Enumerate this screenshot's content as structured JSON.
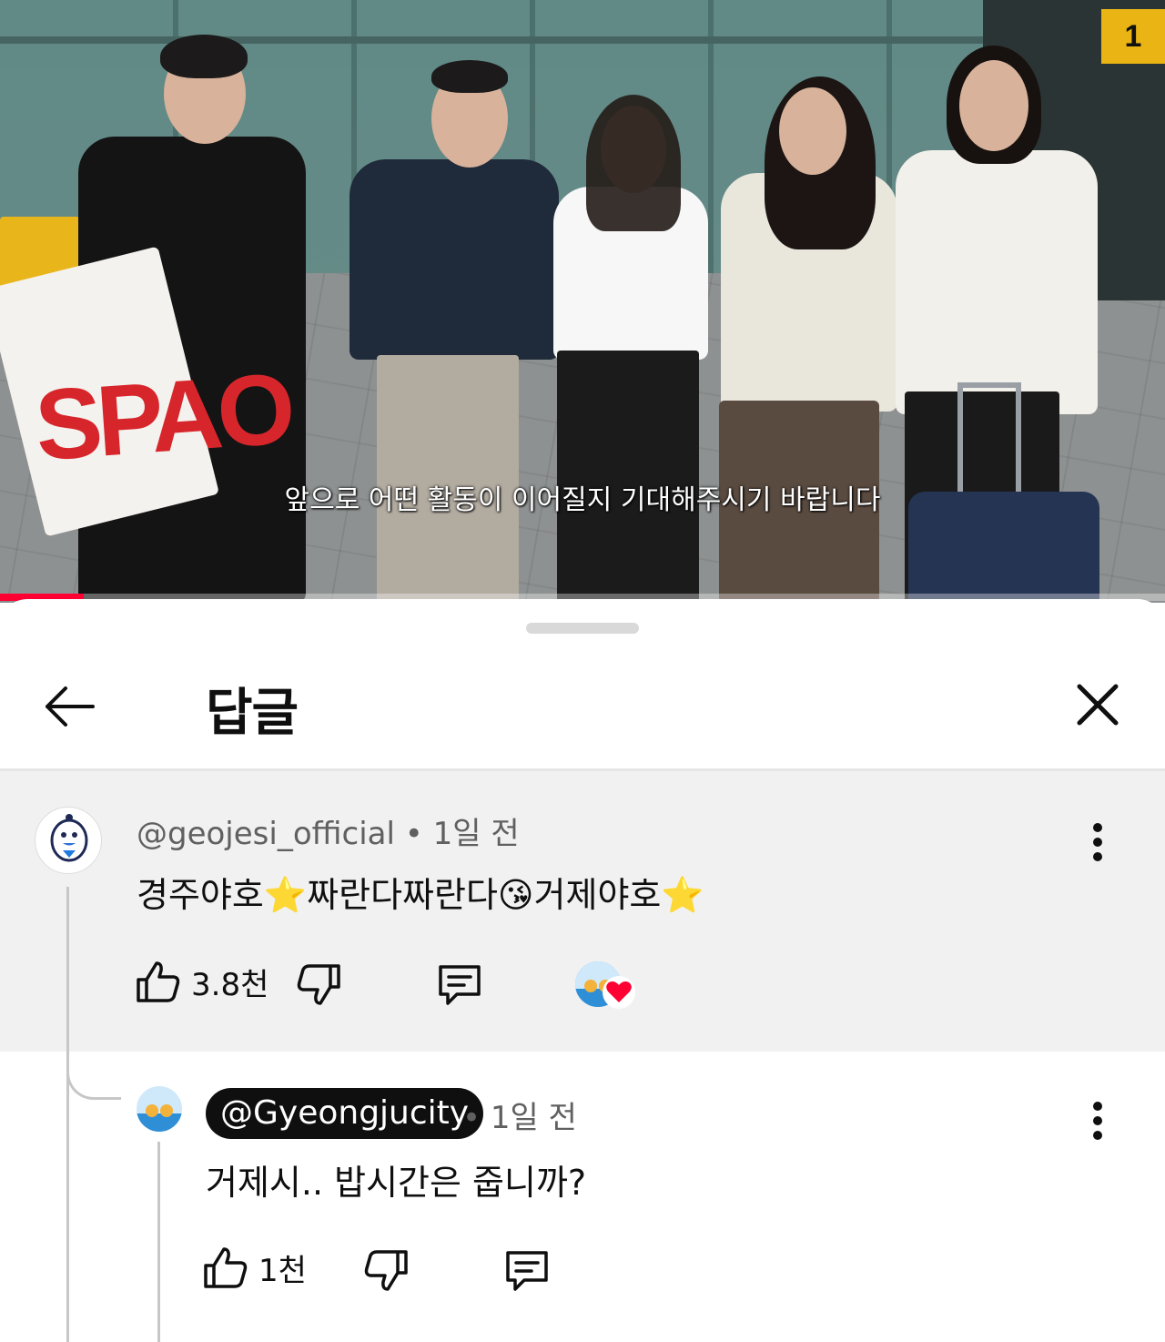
{
  "video": {
    "subtitle": "앞으로 어떤 활동이 이어질지 기대해주시기 바랍니다",
    "progress_fraction": 0.072,
    "gate_number": "1",
    "bag_brand": "SPAO"
  },
  "sheet": {
    "title": "답글"
  },
  "parent_comment": {
    "handle": "@geojesi_official",
    "separator": " • ",
    "age": "1일 전",
    "text": "경주야호⭐짜란다짜란다😘거제야호⭐",
    "like_count": "3.8천"
  },
  "reply": {
    "handle": "@Gyeongjucity",
    "separator": " • ",
    "age": "1일 전",
    "text": "거제시.. 밥시간은 줍니까?",
    "like_count": "1천"
  },
  "colors": {
    "accent": "#ff0033",
    "heart": "#ff0033",
    "parent_bg": "#f1f1f1",
    "pill_bg": "#0f0f0f"
  },
  "icons": [
    "back-arrow-icon",
    "close-icon",
    "thumbs-up-icon",
    "thumbs-down-icon",
    "reply-icon",
    "more-vert-icon",
    "heart-icon"
  ]
}
